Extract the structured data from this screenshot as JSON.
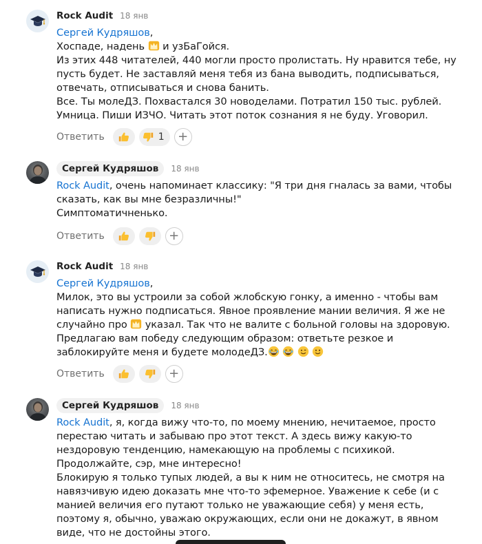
{
  "comments": [
    {
      "author": "Rock Audit",
      "date": "18 янв",
      "avatar": "graduation-cap",
      "mention": "Сергей Кудряшов",
      "mention_suffix": ",",
      "line1_a": "Хоспаде, надень ",
      "line1_b": " и узБаГойся.",
      "lines": [
        "Из этих 448 читателей, 440 могли просто пролистать. Ну нравится тебе, ну",
        "пусть будет. Не заставляй меня тебя из бана выводить, подписываться,",
        "отвечать, отписываться и снова банить.",
        "Все. Ты молеДЗ. Похвастался 30 новоделами. Потратил 150 тыс. рублей.",
        "Умница. Пиши ИЗЧО. Читать этот поток сознания я не буду. Уговорил."
      ],
      "reply_label": "Ответить",
      "dislike_count": "1"
    },
    {
      "author": "Сергей Кудряшов",
      "date": "18 янв",
      "avatar": "user-photo",
      "mention": "Rock Audit",
      "line1_rest": ", очень напоминает классику: \"Я три дня гналась за вами, чтобы",
      "lines": [
        "сказать, как вы мне безразличны!\"",
        "Симптоматичненько."
      ],
      "reply_label": "Ответить"
    },
    {
      "author": "Rock Audit",
      "date": "18 янв",
      "avatar": "graduation-cap",
      "mention": "Сергей Кудряшов",
      "mention_suffix": ",",
      "lines_a": [
        "Милок, это вы устроили за собой жлобскую гонку, а именно - чтобы вам",
        "написать нужно подписаться. Явное проявление мании величия. Я же не"
      ],
      "line_crown_a": "случайно про ",
      "line_crown_b": " указал. Так что не валите с больной головы на здоровую.",
      "line_last_a": "Предлагаю вам победу следующим образом: ответьте резкое и",
      "line_last_b": "заблокируйте меня и будете молодеДЗ.",
      "reply_label": "Ответить"
    },
    {
      "author": "Сергей Кудряшов",
      "date": "18 янв",
      "avatar": "user-photo",
      "mention": "Rock Audit",
      "line1_rest": ", я, когда вижу что-то, по моему мнению, нечитаемое, просто",
      "lines": [
        "перестаю читать и забываю про этот текст. А здесь вижу какую-то",
        "нездоровую тенденцию, намекающую на проблемы с психикой.",
        "Продолжайте, сэр, мне интересно!",
        "Блокирую я только тупых людей, а вы к ним не относитесь, не смотря на",
        "навязчивую идею доказать мне что-то эфемерное. Уважение к себе (и с",
        "манией величия его путают только не уважающие себя) у меня есть,",
        "поэтому я, обычно, уважаю окружающих, если они не докажут, в явном",
        "виде, что не достойны этого."
      ]
    }
  ],
  "colors": {
    "mention": "#1673d1",
    "reaction_bg": "#efefef"
  }
}
